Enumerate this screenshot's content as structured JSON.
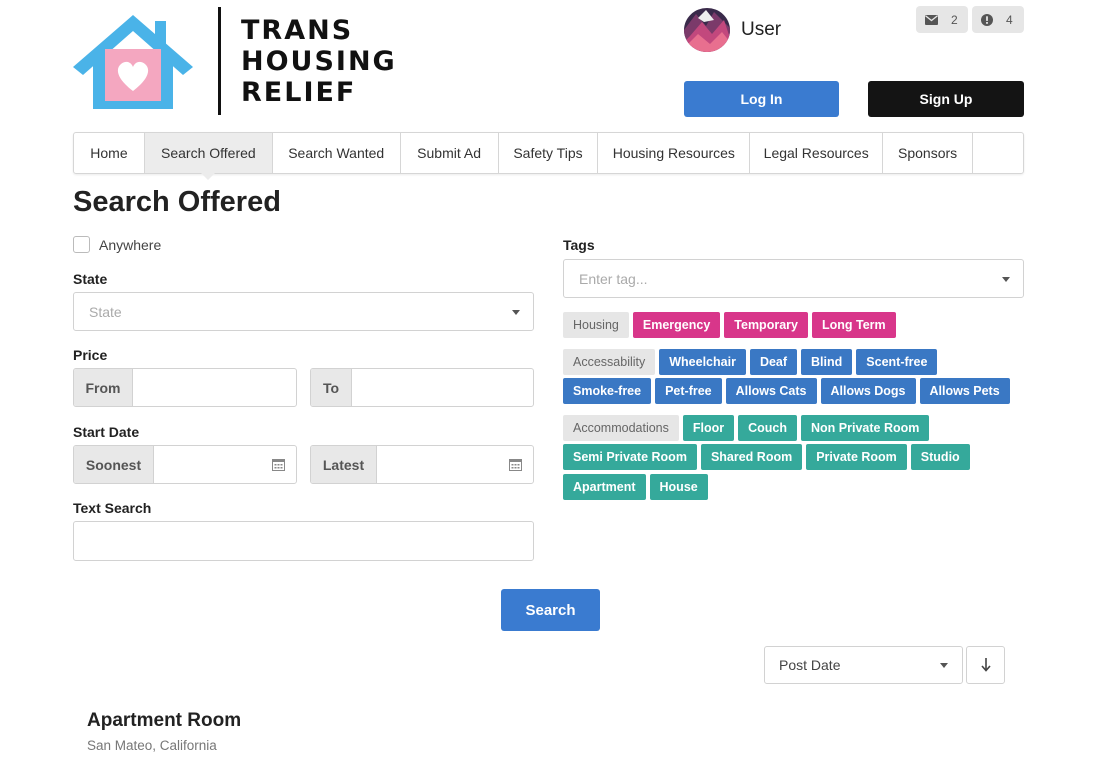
{
  "header": {
    "logo_line1": "TRANS",
    "logo_line2": "HOUSING",
    "logo_line3": "RELIEF",
    "user_name": "User",
    "messages_count": "2",
    "alerts_count": "4",
    "login_label": "Log In",
    "signup_label": "Sign Up",
    "brand_blue": "#4ab3e8",
    "brand_pink": "#f4a7c0"
  },
  "nav": {
    "items": [
      {
        "label": "Home"
      },
      {
        "label": "Search Offered"
      },
      {
        "label": "Search Wanted"
      },
      {
        "label": "Submit Ad"
      },
      {
        "label": "Safety Tips"
      },
      {
        "label": "Housing Resources"
      },
      {
        "label": "Legal Resources"
      },
      {
        "label": "Sponsors"
      }
    ]
  },
  "page": {
    "title": "Search Offered"
  },
  "form": {
    "anywhere_label": "Anywhere",
    "state_label": "State",
    "state_placeholder": "State",
    "price_label": "Price",
    "price_from": "From",
    "price_to": "To",
    "start_date_label": "Start Date",
    "soonest": "Soonest",
    "latest": "Latest",
    "text_search_label": "Text Search",
    "search_button": "Search"
  },
  "tags": {
    "label": "Tags",
    "placeholder": "Enter tag...",
    "housing": {
      "category": "Housing",
      "items": [
        "Emergency",
        "Temporary",
        "Long Term"
      ]
    },
    "accessability": {
      "category": "Accessability",
      "row1": [
        "Wheelchair",
        "Deaf",
        "Blind",
        "Scent-free"
      ],
      "row2": [
        "Smoke-free",
        "Pet-free",
        "Allows Cats",
        "Allows Dogs",
        "Allows Pets"
      ]
    },
    "accommodations": {
      "category": "Accommodations",
      "row1": [
        "Floor",
        "Couch",
        "Non Private Room"
      ],
      "row2": [
        "Semi Private Room",
        "Shared Room",
        "Private Room",
        "Studio"
      ],
      "row3": [
        "Apartment",
        "House"
      ]
    },
    "colors": {
      "housing": "#d8368a",
      "accessability": "#3a78c4",
      "accommodations": "#35a99b"
    }
  },
  "sort": {
    "selected": "Post Date",
    "direction_icon": "arrow-down-icon"
  },
  "listing": {
    "title": "Apartment Room",
    "location": "San Mateo, California"
  }
}
